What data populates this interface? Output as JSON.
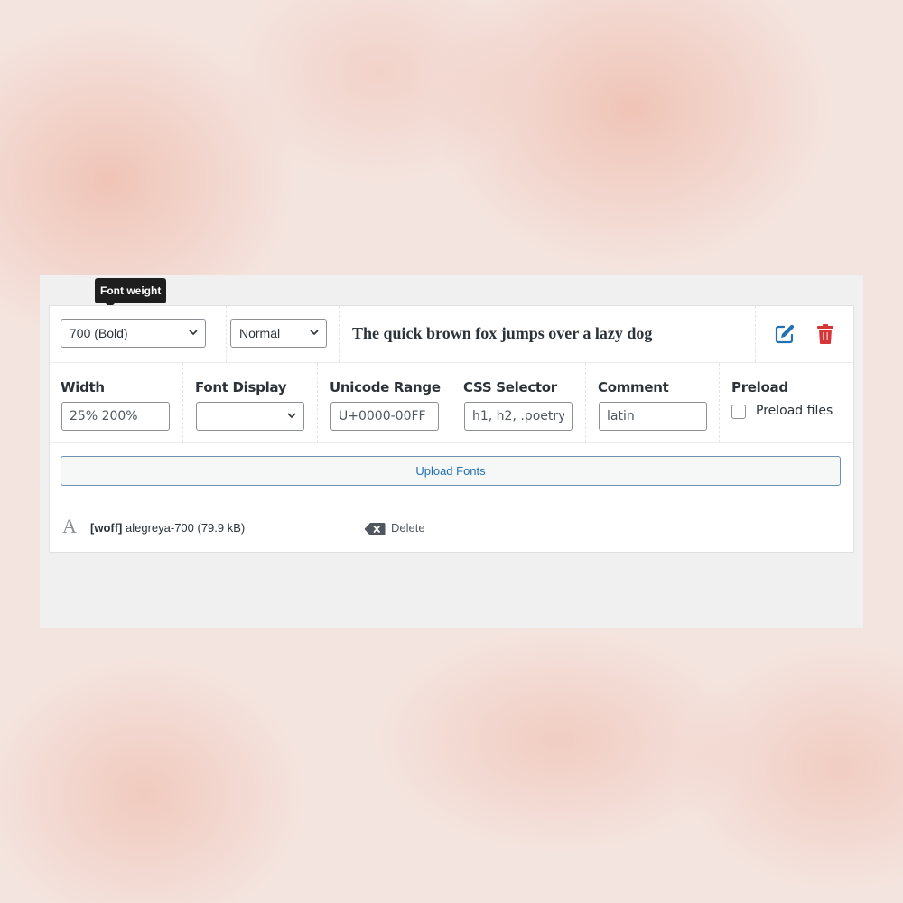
{
  "tooltip": {
    "text": "Font weight"
  },
  "font_row": {
    "weight_select": {
      "value": "700 (Bold)"
    },
    "style_select": {
      "value": "Normal"
    },
    "preview_text": "The quick brown fox jumps over a lazy dog",
    "edit_icon": "edit-icon",
    "delete_icon": "trash-icon",
    "edit_color": "#2271b1",
    "delete_color": "#d63638"
  },
  "fields": {
    "width": {
      "label": "Width",
      "value": "25% 200%"
    },
    "font_display": {
      "label": "Font Display",
      "value": ""
    },
    "unicode_range": {
      "label": "Unicode Range",
      "value": "U+0000-00FF"
    },
    "css_selector": {
      "label": "CSS Selector",
      "value": "h1, h2, .poetry,"
    },
    "comment": {
      "label": "Comment",
      "value": "latin"
    },
    "preload": {
      "label": "Preload",
      "checkbox_label": "Preload files",
      "checked": false
    }
  },
  "upload": {
    "label": "Upload Fonts"
  },
  "file": {
    "icon": "font-file-icon",
    "glyph": "A",
    "format": "[woff]",
    "name": "alegreya-700 (79.9 kB)",
    "delete_label": "Delete"
  }
}
